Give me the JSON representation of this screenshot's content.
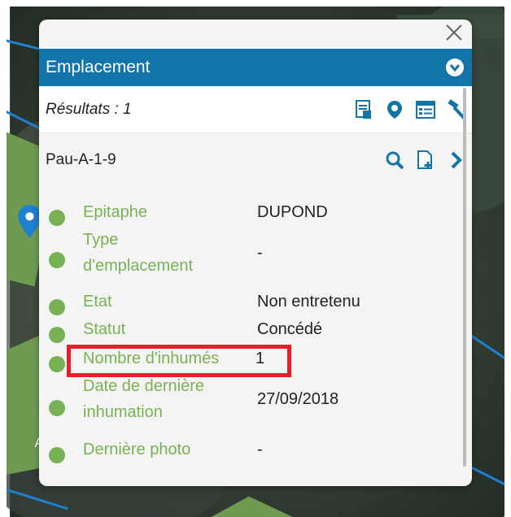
{
  "panel": {
    "title": "Emplacement",
    "results_label": "Résultats : 1",
    "record_name": "Pau-A-1-9"
  },
  "icons": {
    "close": "close-icon",
    "collapse": "chevron-down-circle-icon",
    "results_tools": [
      "report-icon",
      "locate-icon",
      "form-icon",
      "hammer-icon"
    ],
    "record_tools": [
      "search-icon",
      "add-document-icon",
      "chevron-right-icon"
    ]
  },
  "fields": [
    {
      "label": "Epitaphe",
      "value": "DUPOND"
    },
    {
      "label_lines": [
        "Type",
        "d'emplacement"
      ],
      "value": "-"
    },
    {
      "label": "Etat",
      "value": "Non entretenu"
    },
    {
      "label": "Statut",
      "value": "Concédé"
    },
    {
      "label": "Nombre d'inhumés",
      "value": "1"
    },
    {
      "label_lines": [
        "Date de dernière",
        "inhumation"
      ],
      "value": "27/09/2018"
    },
    {
      "label": "Dernière photo",
      "value": "-"
    }
  ],
  "map": {
    "marker_label": "A"
  },
  "colors": {
    "header": "#1274a8",
    "field_label": "#79b254",
    "highlight": "#e52127",
    "icon": "#1274a8"
  }
}
